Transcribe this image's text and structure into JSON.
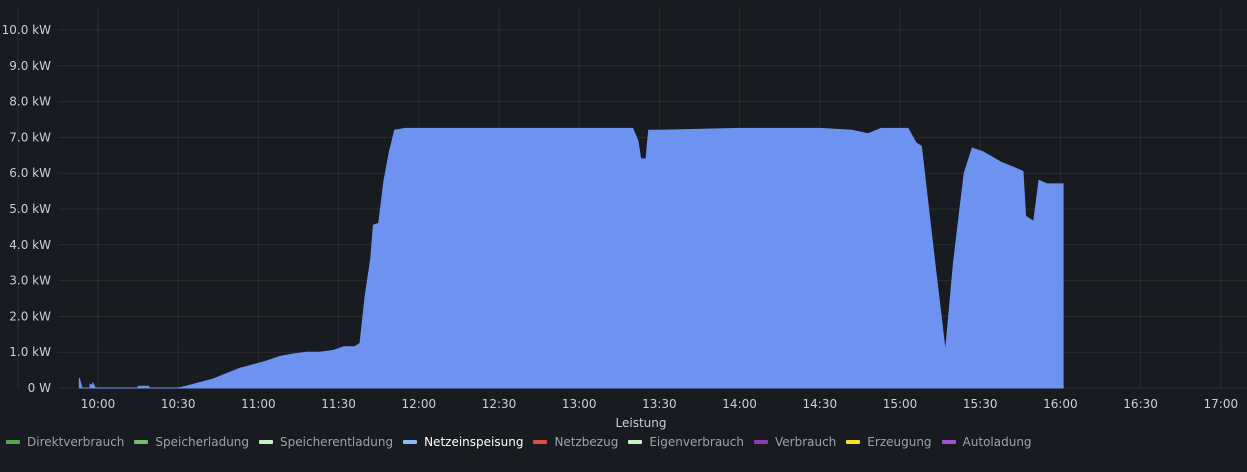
{
  "chart_data": {
    "type": "area",
    "title": "",
    "xlabel": "Leistung",
    "ylabel": "",
    "x_ticks": [
      "10:00",
      "10:30",
      "11:00",
      "11:30",
      "12:00",
      "12:30",
      "13:00",
      "13:30",
      "14:00",
      "14:30",
      "15:00",
      "15:30",
      "16:00",
      "16:30",
      "17:00"
    ],
    "y_ticks": [
      "0 W",
      "1.0 kW",
      "2.0 kW",
      "3.0 kW",
      "4.0 kW",
      "5.0 kW",
      "6.0 kW",
      "7.0 kW",
      "8.0 kW",
      "9.0 kW",
      "10.0 kW"
    ],
    "ylim": [
      0,
      10
    ],
    "y_unit": "kW",
    "xlim": [
      "09:52",
      "17:00"
    ],
    "grid": true,
    "legend_position": "bottom-left",
    "series": [
      {
        "name": "Netzeinspeisung",
        "color": "#6d92ef",
        "points": [
          [
            "09:53",
            0.0
          ],
          [
            "09:53",
            0.28
          ],
          [
            "09:54",
            0.0
          ],
          [
            "09:57",
            0.0
          ],
          [
            "09:57",
            0.1
          ],
          [
            "09:58",
            0.08
          ],
          [
            "09:58",
            0.15
          ],
          [
            "09:59",
            0.0
          ],
          [
            "10:15",
            0.0
          ],
          [
            "10:15",
            0.05
          ],
          [
            "10:19",
            0.05
          ],
          [
            "10:19",
            0.0
          ],
          [
            "10:30",
            0.0
          ],
          [
            "10:33",
            0.05
          ],
          [
            "10:38",
            0.15
          ],
          [
            "10:43",
            0.25
          ],
          [
            "10:48",
            0.4
          ],
          [
            "10:53",
            0.55
          ],
          [
            "10:58",
            0.65
          ],
          [
            "11:03",
            0.75
          ],
          [
            "11:08",
            0.88
          ],
          [
            "11:13",
            0.95
          ],
          [
            "11:18",
            1.0
          ],
          [
            "11:23",
            1.0
          ],
          [
            "11:28",
            1.05
          ],
          [
            "11:32",
            1.15
          ],
          [
            "11:36",
            1.15
          ],
          [
            "11:38",
            1.25
          ],
          [
            "11:40",
            2.6
          ],
          [
            "11:42",
            3.6
          ],
          [
            "11:43",
            4.55
          ],
          [
            "11:45",
            4.6
          ],
          [
            "11:47",
            5.8
          ],
          [
            "11:49",
            6.6
          ],
          [
            "11:51",
            7.2
          ],
          [
            "11:55",
            7.25
          ],
          [
            "12:30",
            7.25
          ],
          [
            "13:00",
            7.25
          ],
          [
            "13:20",
            7.25
          ],
          [
            "13:22",
            6.9
          ],
          [
            "13:23",
            6.4
          ],
          [
            "13:25",
            6.4
          ],
          [
            "13:26",
            7.2
          ],
          [
            "13:30",
            7.2
          ],
          [
            "14:00",
            7.25
          ],
          [
            "14:30",
            7.25
          ],
          [
            "14:42",
            7.2
          ],
          [
            "14:48",
            7.1
          ],
          [
            "14:53",
            7.25
          ],
          [
            "15:03",
            7.25
          ],
          [
            "15:06",
            6.85
          ],
          [
            "15:08",
            6.75
          ],
          [
            "15:13",
            3.5
          ],
          [
            "15:17",
            1.0
          ],
          [
            "15:20",
            3.5
          ],
          [
            "15:24",
            6.0
          ],
          [
            "15:27",
            6.7
          ],
          [
            "15:31",
            6.6
          ],
          [
            "15:38",
            6.3
          ],
          [
            "15:43",
            6.15
          ],
          [
            "15:46",
            6.05
          ],
          [
            "15:47",
            4.8
          ],
          [
            "15:50",
            4.65
          ],
          [
            "15:52",
            5.8
          ],
          [
            "15:55",
            5.7
          ],
          [
            "16:01",
            5.7
          ],
          [
            "16:01",
            0.0
          ]
        ]
      }
    ]
  },
  "legend": [
    {
      "label": "Direktverbrauch",
      "color": "#56a64b",
      "active": false
    },
    {
      "label": "Speicherladung",
      "color": "#73bf69",
      "active": false
    },
    {
      "label": "Speicherentladung",
      "color": "#c8f2c2",
      "active": false
    },
    {
      "label": "Netzeinspeisung",
      "color": "#8ab8ff",
      "active": true
    },
    {
      "label": "Netzbezug",
      "color": "#e24d42",
      "active": false
    },
    {
      "label": "Eigenverbrauch",
      "color": "#c8f2c2",
      "active": false
    },
    {
      "label": "Verbrauch",
      "color": "#8f3bb8",
      "active": false
    },
    {
      "label": "Erzeugung",
      "color": "#fade2a",
      "active": false
    },
    {
      "label": "Autoladung",
      "color": "#a352cc",
      "active": false
    }
  ]
}
